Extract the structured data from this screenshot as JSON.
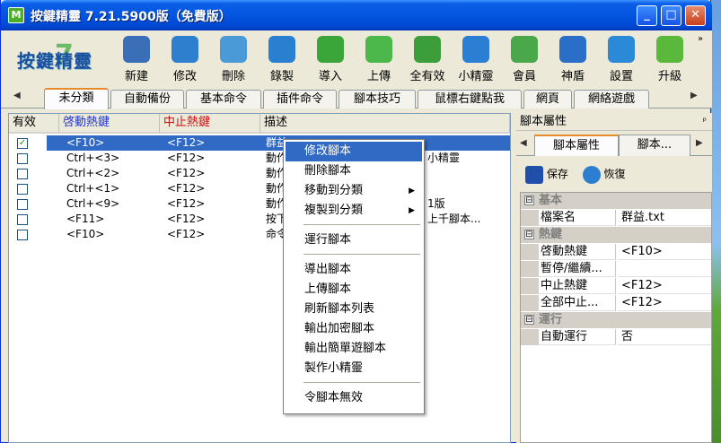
{
  "window": {
    "title": "按鍵精靈 7.21.5900版（免費版）",
    "app_icon": "M"
  },
  "titlebar_buttons": {
    "minimize": "_",
    "maximize": "□",
    "close": "✕"
  },
  "logo": {
    "text": "按鍵精靈",
    "mark": "7"
  },
  "toolbar": [
    {
      "label": "新建",
      "icon": "new-icon",
      "color": "#3a6fb8"
    },
    {
      "label": "修改",
      "icon": "edit-icon",
      "color": "#2f7fcf"
    },
    {
      "label": "刪除",
      "icon": "trash-icon",
      "color": "#4a9ad8"
    },
    {
      "label": "錄製",
      "icon": "record-icon",
      "color": "#2a80d0"
    },
    {
      "label": "導入",
      "icon": "import-icon",
      "color": "#3aa63a"
    },
    {
      "label": "上傳",
      "icon": "upload-icon",
      "color": "#4cb84c"
    },
    {
      "label": "全有效",
      "icon": "check-all-icon",
      "color": "#3b9e3b"
    },
    {
      "label": "小精靈",
      "icon": "house-icon",
      "color": "#2a7fd4"
    },
    {
      "label": "會員",
      "icon": "user-icon",
      "color": "#4aa84a"
    },
    {
      "label": "神盾",
      "icon": "shield-icon",
      "color": "#2a6ec8"
    },
    {
      "label": "設置",
      "icon": "gear-icon",
      "color": "#2a8ad8"
    },
    {
      "label": "升級",
      "icon": "upgrade-icon",
      "color": "#5ab83a"
    }
  ],
  "toolbar_more": "»",
  "tabs": [
    "未分類",
    "自動備份",
    "基本命令",
    "插件命令",
    "腳本技巧",
    "鼠標右鍵點我",
    "網頁",
    "網絡遊戲"
  ],
  "tab_scroll": {
    "left": "◀",
    "right": "▶"
  },
  "list": {
    "columns": {
      "enabled": "有效",
      "start_key": "啓動熱鍵",
      "stop_key": "中止熱鍵",
      "desc": "描述"
    },
    "column_colors": {
      "start_key": "#2233cc",
      "stop_key": "#cc1111"
    },
    "rows": [
      {
        "checked": true,
        "start": "<F10>",
        "stop": "<F12>",
        "desc": "群益"
      },
      {
        "checked": false,
        "start": "Ctrl+<3>",
        "stop": "<F12>",
        "desc": "動作",
        "tail": "小精靈"
      },
      {
        "checked": false,
        "start": "Ctrl+<2>",
        "stop": "<F12>",
        "desc": "動作"
      },
      {
        "checked": false,
        "start": "Ctrl+<1>",
        "stop": "<F12>",
        "desc": "動作"
      },
      {
        "checked": false,
        "start": "Ctrl+<9>",
        "stop": "<F12>",
        "desc": "動作",
        "tail": "1版"
      },
      {
        "checked": false,
        "start": "<F11>",
        "stop": "<F12>",
        "desc": "按下",
        "tail": "上千腳本..."
      },
      {
        "checked": false,
        "start": "<F10>",
        "stop": "<F12>",
        "desc": "命令"
      }
    ]
  },
  "context_menu": {
    "items": [
      {
        "label": "修改腳本",
        "highlighted": true
      },
      {
        "label": "刪除腳本"
      },
      {
        "label": "移動到分類",
        "submenu": "▶"
      },
      {
        "label": "複製到分類",
        "submenu": "▶"
      },
      {
        "label": "運行腳本"
      },
      {
        "label": "導出腳本"
      },
      {
        "label": "上傳腳本"
      },
      {
        "label": "刷新腳本列表"
      },
      {
        "label": "輸出加密腳本"
      },
      {
        "label": "輸出簡單遊腳本"
      },
      {
        "label": "製作小精靈"
      },
      {
        "label": "令腳本無效"
      }
    ]
  },
  "properties": {
    "header": "腳本屬性",
    "pin": "ᵖ",
    "tabs": [
      "腳本屬性",
      "腳本..."
    ],
    "tab_scroll": {
      "left": "◀",
      "right": "▶"
    },
    "save_label": "保存",
    "restore_label": "恢復",
    "categories": [
      {
        "name": "基本",
        "toggle": "⊟",
        "rows": [
          {
            "key": "檔案名",
            "value": "群益.txt"
          }
        ]
      },
      {
        "name": "熱鍵",
        "toggle": "⊟",
        "rows": [
          {
            "key": "啓動熱鍵",
            "value": "<F10>"
          },
          {
            "key": "暫停/繼續...",
            "value": ""
          },
          {
            "key": "中止熱鍵",
            "value": "<F12>"
          },
          {
            "key": "全部中止...",
            "value": "<F12>"
          }
        ]
      },
      {
        "name": "運行",
        "toggle": "⊟",
        "rows": [
          {
            "key": "自動運行",
            "value": "否"
          }
        ]
      }
    ]
  }
}
